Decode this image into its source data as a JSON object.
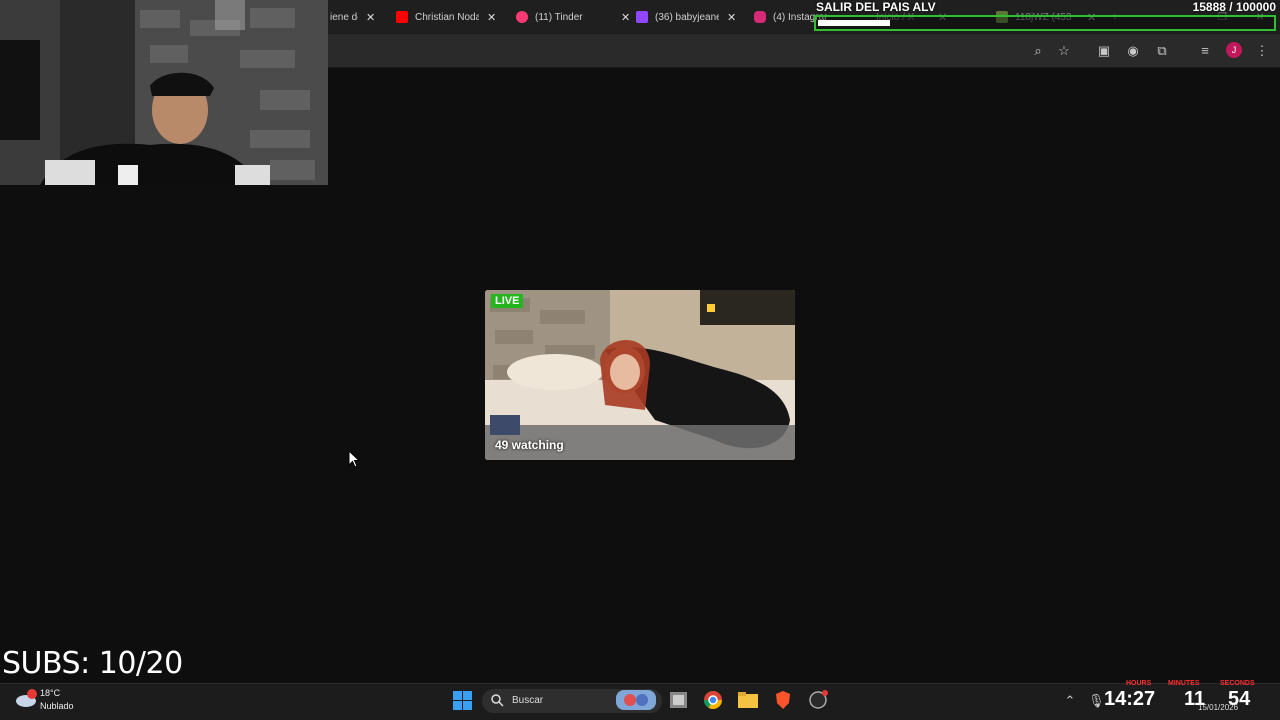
{
  "browser": {
    "tabs": [
      {
        "title": "iene de",
        "favicon_color": "#6f6f6f"
      },
      {
        "title": "Christian Noda",
        "favicon_color": "#ff0000"
      },
      {
        "title": "(11) Tinder",
        "favicon_color": "#fd3a73"
      },
      {
        "title": "(36) babyjeane",
        "favicon_color": "#9146ff"
      },
      {
        "title": "(4) Instagram",
        "favicon_color": "#d62976"
      },
      {
        "title": "Inicio / X",
        "favicon_color": "#444444"
      },
      {
        "title": "118jWZ (453",
        "favicon_color": "#8bc34a"
      }
    ],
    "close_glyph": "✕",
    "profile_initial": "J"
  },
  "overlay": {
    "goal_title": "SALIR DEL PAIS ALV",
    "goal_count": "15888 / 100000",
    "goal_progress": 0.1589,
    "subs_text": "SUBS: 10/20",
    "accent_green": "#2fbf2f"
  },
  "stream_card": {
    "live_badge": "LIVE",
    "viewers": "49 watching",
    "badge_color": "#25b61f"
  },
  "taskbar": {
    "weather_temp": "18°C",
    "weather_desc": "Nublado",
    "search_placeholder": "Buscar",
    "clock_time": "14:27",
    "timer_hours": "11",
    "timer_seconds": "54",
    "timer_labels": [
      "HOURS",
      "MINUTES",
      "SECONDS"
    ],
    "date": "15/01/2026"
  }
}
